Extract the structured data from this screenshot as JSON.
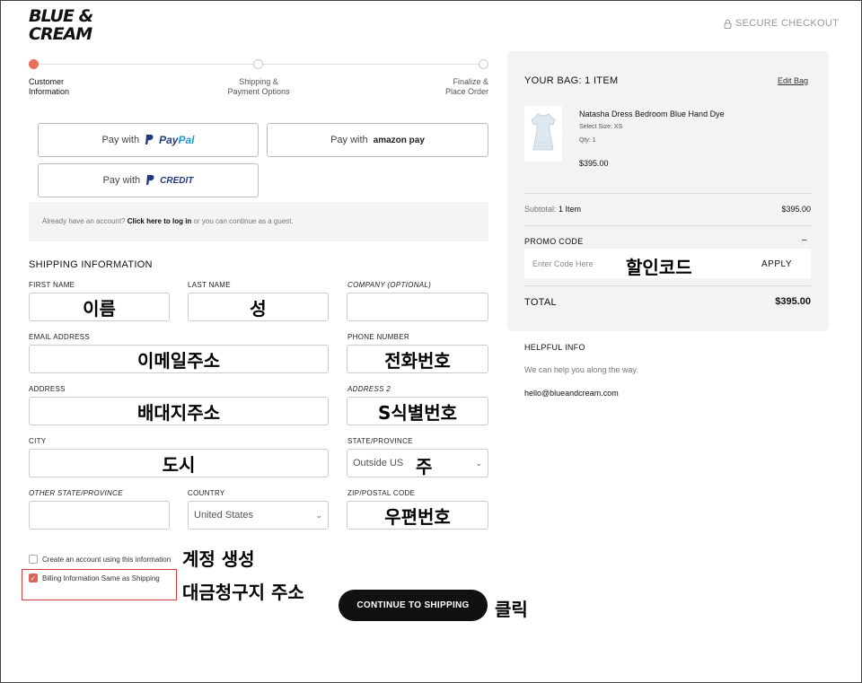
{
  "brand": {
    "line1": "BLUE &",
    "line2": "CREAM"
  },
  "secure_checkout": "SECURE CHECKOUT",
  "steps": [
    {
      "line1": "Customer",
      "line2": "Information"
    },
    {
      "line1": "Shipping &",
      "line2": "Payment Options"
    },
    {
      "line1": "Finalize &",
      "line2": "Place Order"
    }
  ],
  "payments": {
    "pay_with": "Pay with",
    "paypal_a": "Pay",
    "paypal_b": "Pal",
    "amazon": "amazon pay",
    "credit": "CREDIT"
  },
  "guest": {
    "prefix": "Already have an account? ",
    "link": "Click here to log in",
    "suffix": " or you can continue as a guest."
  },
  "shipping": {
    "title": "SHIPPING INFORMATION",
    "labels": {
      "first": "FIRST NAME",
      "last": "LAST NAME",
      "company": "COMPANY (OPTIONAL)",
      "email": "EMAIL ADDRESS",
      "phone": "PHONE NUMBER",
      "address": "ADDRESS",
      "address2": "ADDRESS 2",
      "city": "CITY",
      "state": "STATE/PROVINCE",
      "other_state": "OTHER STATE/PROVINCE",
      "country": "COUNTRY",
      "zip": "ZIP/POSTAL CODE"
    },
    "state_value": "Outside US",
    "country_value": "United States"
  },
  "annotations": {
    "first": "이름",
    "last": "성",
    "email": "이메일주소",
    "phone": "전화번호",
    "address": "배대지주소",
    "address2": "S식별번호",
    "city": "도시",
    "state": "주",
    "zip": "우편번호",
    "promo": "할인코드",
    "create_account": "계정 생성",
    "billing": "대금청구지 주소",
    "click": "클릭"
  },
  "checkboxes": {
    "create_account": "Create an account using this information",
    "billing_same": "Billing Information Same as Shipping"
  },
  "continue_button": "CONTINUE TO SHIPPING",
  "bag": {
    "title": "YOUR BAG: 1 ITEM",
    "edit": "Edit Bag",
    "item_name": "Natasha Dress Bedroom Blue Hand Dye",
    "item_size": "Select Size: XS",
    "item_qty": "Qty: 1",
    "item_price": "$395.00",
    "subtotal_label": "Subtotal:",
    "subtotal_count": "1 Item",
    "subtotal_value": "$395.00",
    "promo_label": "PROMO CODE",
    "promo_toggle": "–",
    "promo_placeholder": "Enter Code Here",
    "apply": "APPLY",
    "total_label": "TOTAL",
    "total_value": "$395.00"
  },
  "help": {
    "title": "HELPFUL INFO",
    "desc": "We can help you along the way.",
    "email": "hello@blueandcream.com"
  },
  "colors": {
    "accent": "#e8705f",
    "button": "#111111",
    "panel": "#f4f3f1",
    "highlight": "#d23b3b"
  }
}
